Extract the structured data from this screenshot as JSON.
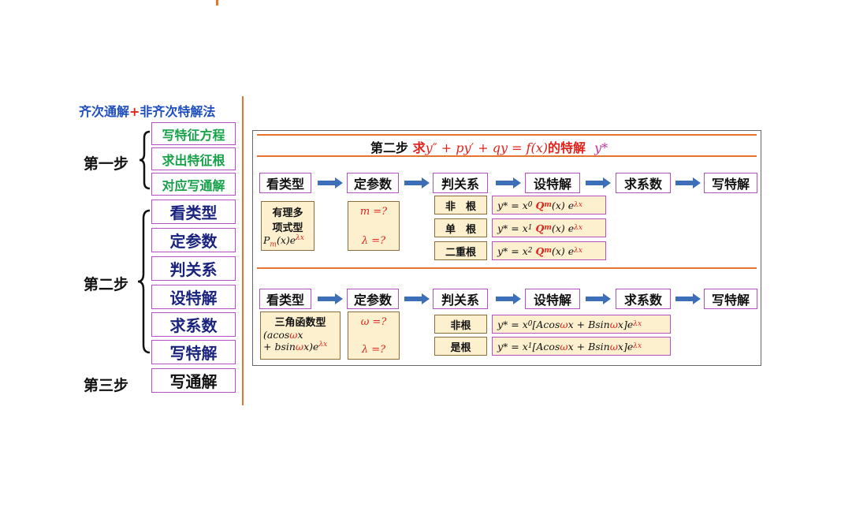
{
  "left": {
    "title_a": "齐次通解",
    "title_plus": "+",
    "title_b": "非齐次特解法",
    "step1": "第一步",
    "step1_items": [
      "写特征方程",
      "求出特征根",
      "对应写通解"
    ],
    "step2": "第二步",
    "step2_items": [
      "看类型",
      "定参数",
      "判关系",
      "设特解",
      "求系数",
      "写特解"
    ],
    "step3": "第三步",
    "step3_item": "写通解"
  },
  "panel": {
    "header_black": "第二步",
    "header_red_1": "求",
    "header_eq": "y″ + py′ + qy = f(x)",
    "header_red_2": "的特解",
    "header_y": "y*",
    "flow": [
      "看类型",
      "定参数",
      "判关系",
      "设特解",
      "求系数",
      "写特解"
    ],
    "case1": {
      "type_l1": "有理多",
      "type_l2": "项式型",
      "type_formula_a": "P",
      "type_formula_sub": "m",
      "type_formula_b": "(x)e",
      "type_formula_sup": "λx",
      "param_1": "m =?",
      "param_2": "λ =?",
      "relations": [
        "非　根",
        "单　根",
        "二重根"
      ],
      "powers": [
        "0",
        "1",
        "2"
      ],
      "forms_a": "y* = x",
      "forms_q": "Q",
      "forms_qsub": "m",
      "forms_b": "(x) e",
      "forms_sup": "λx"
    },
    "case2": {
      "type_l1": "三角函数型",
      "type_l2a": "(acos",
      "type_l2w": "ω",
      "type_l2b": "x",
      "type_l3a": "+ bsin",
      "type_l3w": "ω",
      "type_l3b": "x)e",
      "type_l3sup": "λx",
      "param_1": "ω =?",
      "param_2": "λ =?",
      "relations": [
        "非根",
        "是根"
      ],
      "powers": [
        "0",
        "1"
      ],
      "forms_a": "y* = x",
      "forms_b": "[Acos",
      "forms_w1": "ω",
      "forms_c": "x + Bsin",
      "forms_w2": "ω",
      "forms_d": "x]e",
      "forms_sup": "λx"
    }
  },
  "colors": {
    "orange": "#e5742c",
    "purple_border": "#b44fc4",
    "green_text": "#17a24a",
    "navy_text": "#1a237e",
    "red": "#e0241c",
    "tan_fill": "#fdf0cf",
    "arrow_blue": "#3d6fb8"
  }
}
